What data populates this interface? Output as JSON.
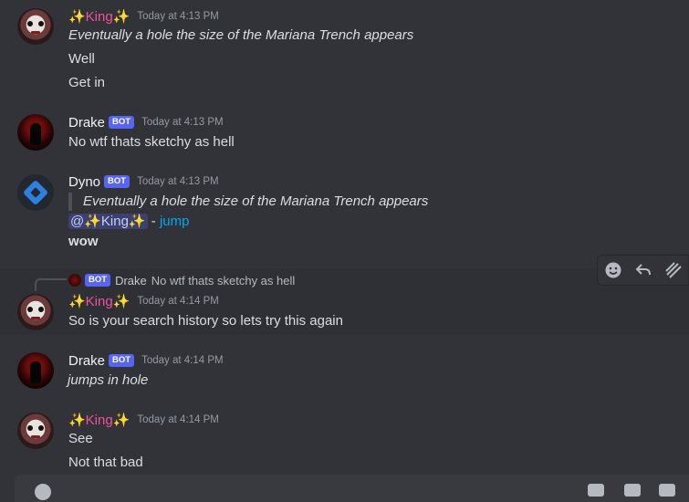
{
  "users": {
    "king": "✨King✨",
    "drake": "Drake",
    "dyno": "Dyno",
    "bot_tag": "BOT"
  },
  "messages": [
    {
      "author": "✨King✨",
      "timestamp": "Today at 4:13 PM",
      "lines": [
        "Eventually a hole the size of the Mariana Trench appears",
        "Well",
        "Get in"
      ]
    },
    {
      "author": "Drake",
      "timestamp": "Today at 4:13 PM",
      "lines": [
        "No wtf thats sketchy as hell"
      ]
    },
    {
      "author": "Dyno",
      "timestamp": "Today at 4:13 PM",
      "quote": "Eventually a hole the size of the Mariana Trench appears",
      "mention": "@✨King✨",
      "separator": " - ",
      "link": "jump",
      "bold_line": "wow"
    },
    {
      "author": "✨King✨",
      "timestamp": "Today at 4:14 PM",
      "reply_to": {
        "author": "Drake",
        "text": "No wtf thats sketchy as hell"
      },
      "lines": [
        "So is your search history so lets try this again"
      ]
    },
    {
      "author": "Drake",
      "timestamp": "Today at 4:14 PM",
      "lines": [
        "jumps in hole"
      ]
    },
    {
      "author": "✨King✨",
      "timestamp": "Today at 4:14 PM",
      "lines": [
        "See",
        "Not that bad"
      ]
    }
  ],
  "toolbar": {
    "icons": [
      "add-reaction-icon",
      "reply-icon",
      "create-thread-icon"
    ]
  },
  "colors": {
    "background": "#313338",
    "king_name": "#f0529b",
    "bot_badge": "#5865f2",
    "link": "#00a8fc"
  }
}
